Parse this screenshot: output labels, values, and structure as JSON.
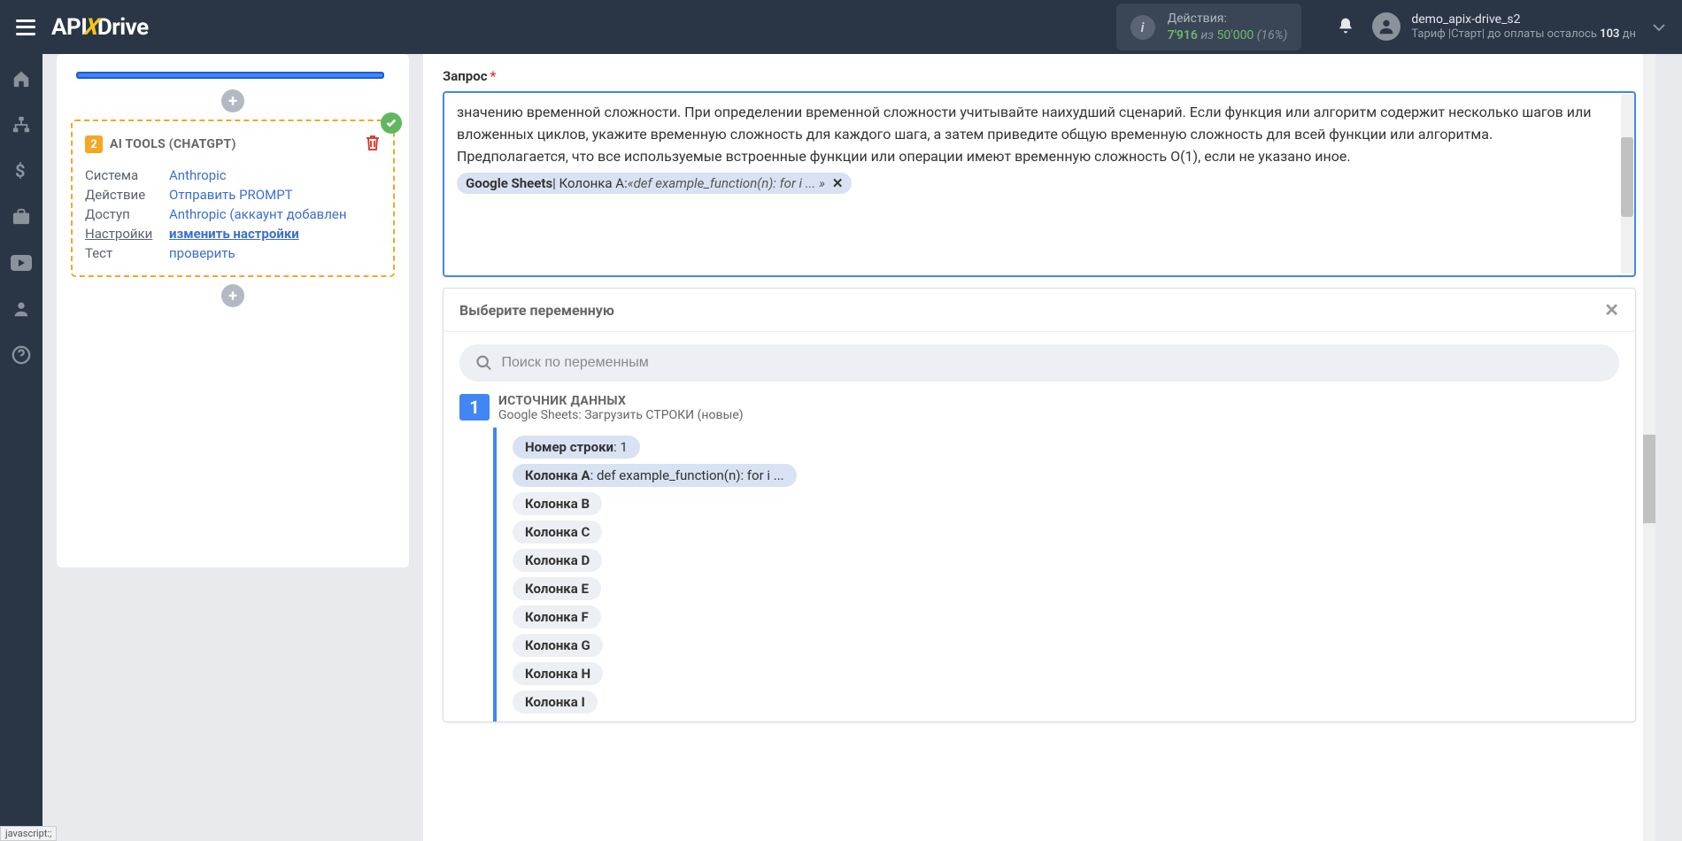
{
  "header": {
    "logo_api": "API",
    "logo_x": "X",
    "logo_drive": "Drive",
    "actions_label": "Действия:",
    "actions_count1": "7'916",
    "actions_iz": " из ",
    "actions_count2": "50'000",
    "actions_pct": " (16%)",
    "username": "demo_apix-drive_s2",
    "tariff_prefix": "Тариф |Старт|  до оплаты осталось ",
    "tariff_days": "103",
    "tariff_suffix": " дн"
  },
  "card": {
    "number": "2",
    "title": "AI TOOLS (CHATGPT)",
    "rows": {
      "system_key": "Система",
      "system_val": "Anthropic",
      "action_key": "Действие",
      "action_val": "Отправить PROMPT",
      "access_key": "Доступ",
      "access_val": "Anthropic (аккаунт добавлен",
      "settings_key": "Настройки",
      "settings_val": "изменить настройки",
      "test_key": "Тест",
      "test_val": "проверить"
    }
  },
  "request": {
    "label": "Запрос",
    "text": "значению временной сложности. При определении временной сложности учитывайте наихудший сценарий. Если функция или алгоритм содержит несколько шагов или вложенных циклов, укажите временную сложность для каждого шага, а затем приведите общую временную сложность для всей функции или алгоритма. Предполагается, что все используемые встроенные функции или операции имеют временную сложность O(1), если не указано иное.",
    "tag_source": "Google Sheets",
    "tag_sep": " | Колонка A: ",
    "tag_value": "«def example_function(n): for i ... »"
  },
  "dropdown": {
    "title": "Выберите переменную",
    "search_placeholder": "Поиск по переменным",
    "source_num": "1",
    "source_title": "ИСТОЧНИК ДАННЫХ",
    "source_sub": "Google Sheets: Загрузить СТРОКИ (новые)",
    "vars": [
      {
        "label": "Номер строки",
        "value": ": 1",
        "selected": true
      },
      {
        "label": "Колонка A",
        "value": ": def example_function(n): for i ...",
        "selected": true
      },
      {
        "label": "Колонка B",
        "value": "",
        "selected": false
      },
      {
        "label": "Колонка C",
        "value": "",
        "selected": false
      },
      {
        "label": "Колонка D",
        "value": "",
        "selected": false
      },
      {
        "label": "Колонка E",
        "value": "",
        "selected": false
      },
      {
        "label": "Колонка F",
        "value": "",
        "selected": false
      },
      {
        "label": "Колонка G",
        "value": "",
        "selected": false
      },
      {
        "label": "Колонка H",
        "value": "",
        "selected": false
      },
      {
        "label": "Колонка I",
        "value": "",
        "selected": false
      }
    ]
  },
  "footer": {
    "status": "javascript:;"
  }
}
